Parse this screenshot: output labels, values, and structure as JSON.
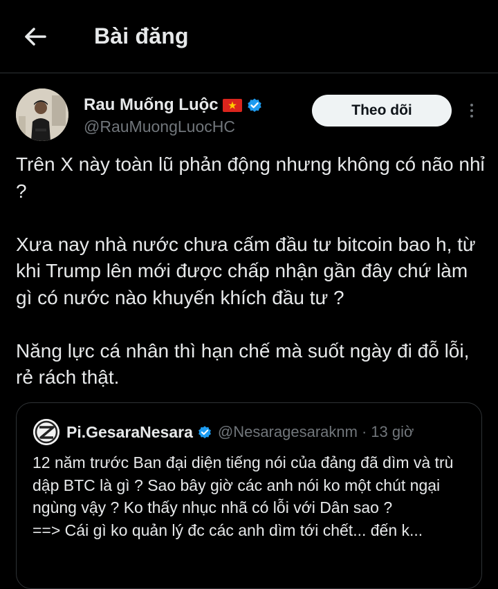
{
  "header": {
    "title": "Bài đăng",
    "back_icon": "arrow-left-icon"
  },
  "author": {
    "display_name": "Rau Muống Luộc",
    "flag": "vietnam-flag-icon",
    "handle": "@RauMuongLuocHC",
    "verified": true,
    "verified_color": "#1d9bf0"
  },
  "follow_button": {
    "label": "Theo dõi"
  },
  "tweet": {
    "paragraphs": [
      "Trên X này toàn lũ phản động nhưng không có não nhỉ ?",
      "Xưa nay nhà nước chưa cấm đầu tư bitcoin bao h, từ khi Trump lên mới được chấp nhận gần đây chứ làm gì có nước nào khuyến khích đầu tư ?",
      "Năng lực cá nhân thì hạn chế mà suốt ngày đi đỗ lỗi, rẻ rách thật."
    ]
  },
  "quote": {
    "display_name": "Pi.GesaraNesara",
    "handle": "@Nesaragesaraknm",
    "separator": "·",
    "time": "13 giờ",
    "lines": [
      "12 năm trước Ban đại diện tiếng nói của đảng đã dìm và trù dập BTC là gì ? Sao bây giờ các anh nói ko một chút ngại ngùng vậy ? Ko thấy nhục nhã có lỗi với Dân sao ?",
      "==> Cái gì ko quản lý đc các anh dìm tới chết... đến k..."
    ]
  },
  "colors": {
    "background": "#000000",
    "text": "#e7e9ea",
    "secondary": "#71767b",
    "border": "#2f3336",
    "follow_bg": "#eff3f4"
  }
}
